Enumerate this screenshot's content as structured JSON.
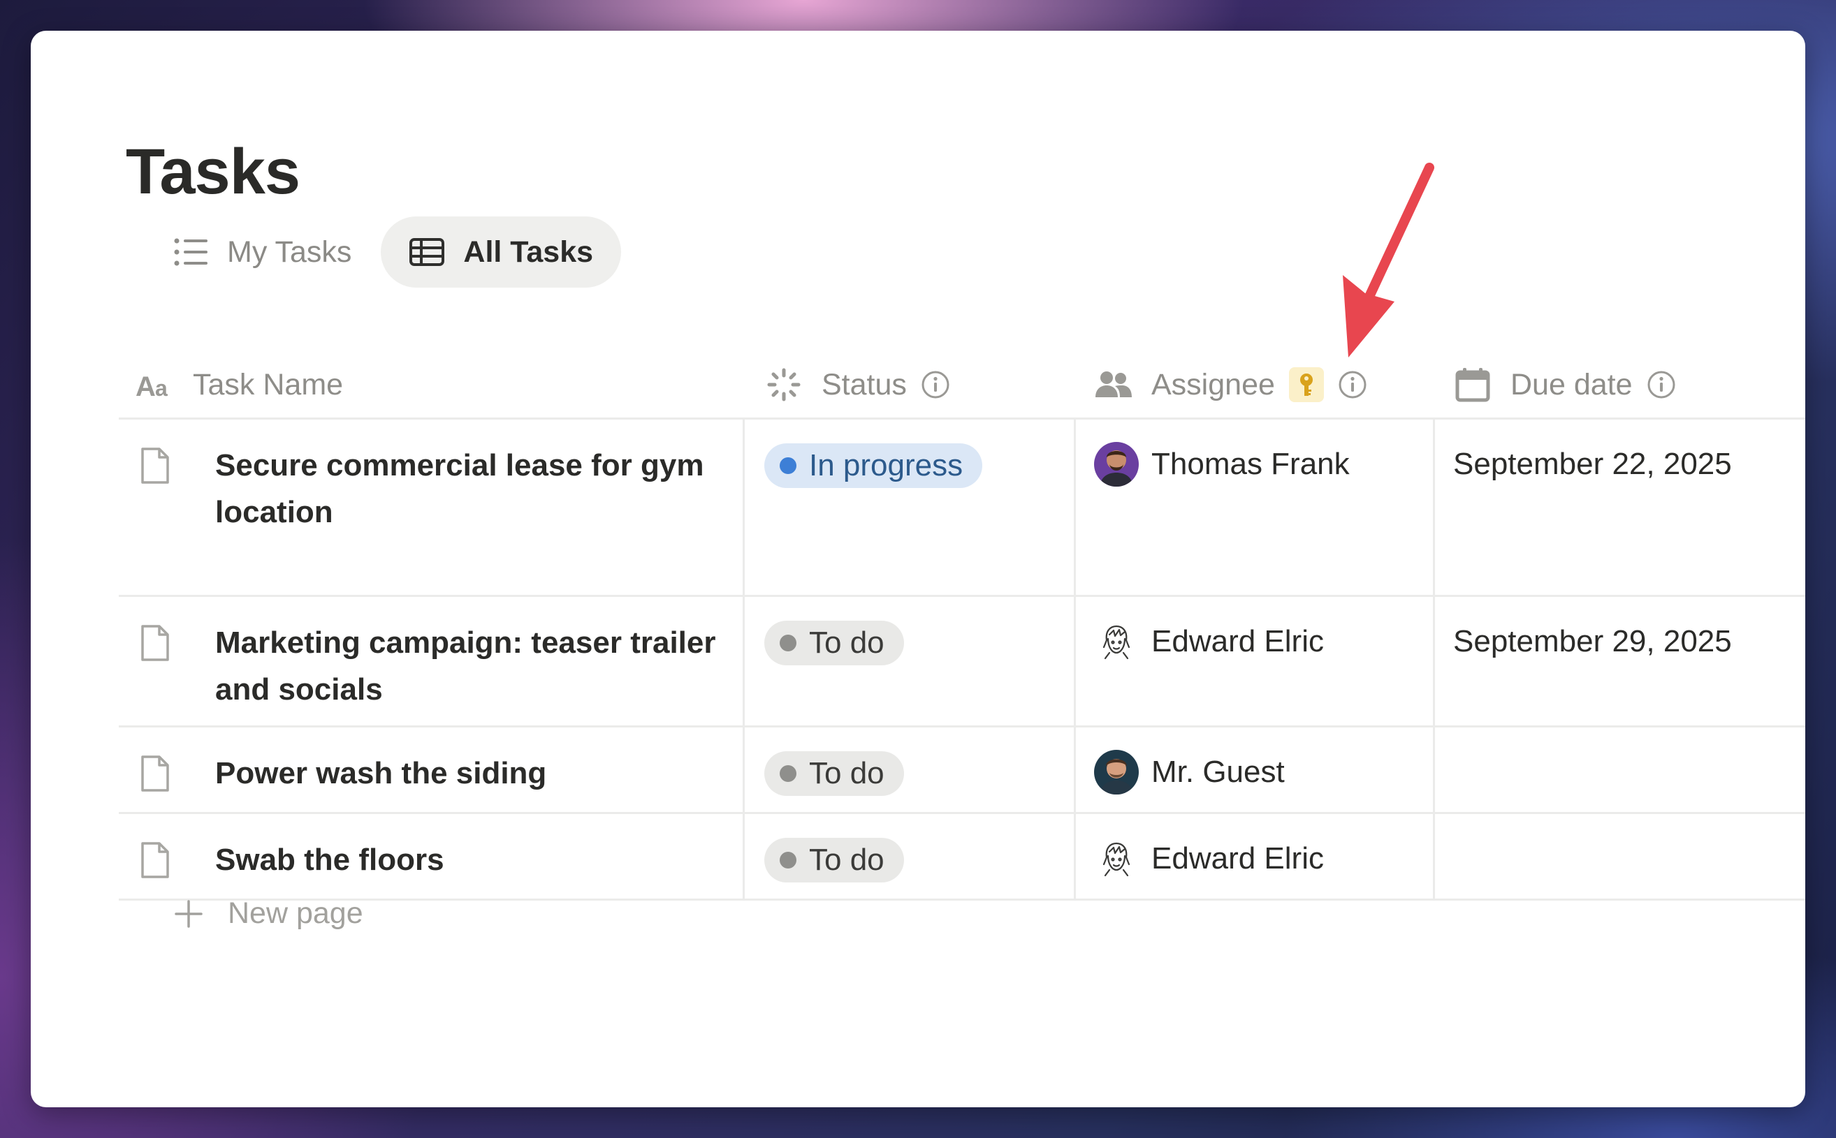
{
  "page": {
    "title": "Tasks"
  },
  "views": [
    {
      "label": "My Tasks",
      "icon": "list-icon",
      "active": false
    },
    {
      "label": "All Tasks",
      "icon": "table-icon",
      "active": true
    }
  ],
  "columns": {
    "task_name": "Task Name",
    "status": "Status",
    "assignee": "Assignee",
    "due_date": "Due date"
  },
  "rows": [
    {
      "name": "Secure commercial lease for gym location",
      "status": "In progress",
      "assignee": "Thomas Frank",
      "due": "September 22, 2025"
    },
    {
      "name": "Marketing campaign: teaser trailer and socials",
      "status": "To do",
      "assignee": "Edward Elric",
      "due": "September 29, 2025"
    },
    {
      "name": "Power wash the siding",
      "status": "To do",
      "assignee": "Mr. Guest",
      "due": ""
    },
    {
      "name": "Swab the floors",
      "status": "To do",
      "assignee": "Edward Elric",
      "due": ""
    }
  ],
  "new_page_label": "New page",
  "colors": {
    "in_progress_bg": "#dbe7f6",
    "in_progress_dot": "#3d7fd6",
    "todo_bg": "#e9e9e7",
    "annotation_arrow": "#e8464f",
    "key_badge": "#fbf0c9"
  }
}
